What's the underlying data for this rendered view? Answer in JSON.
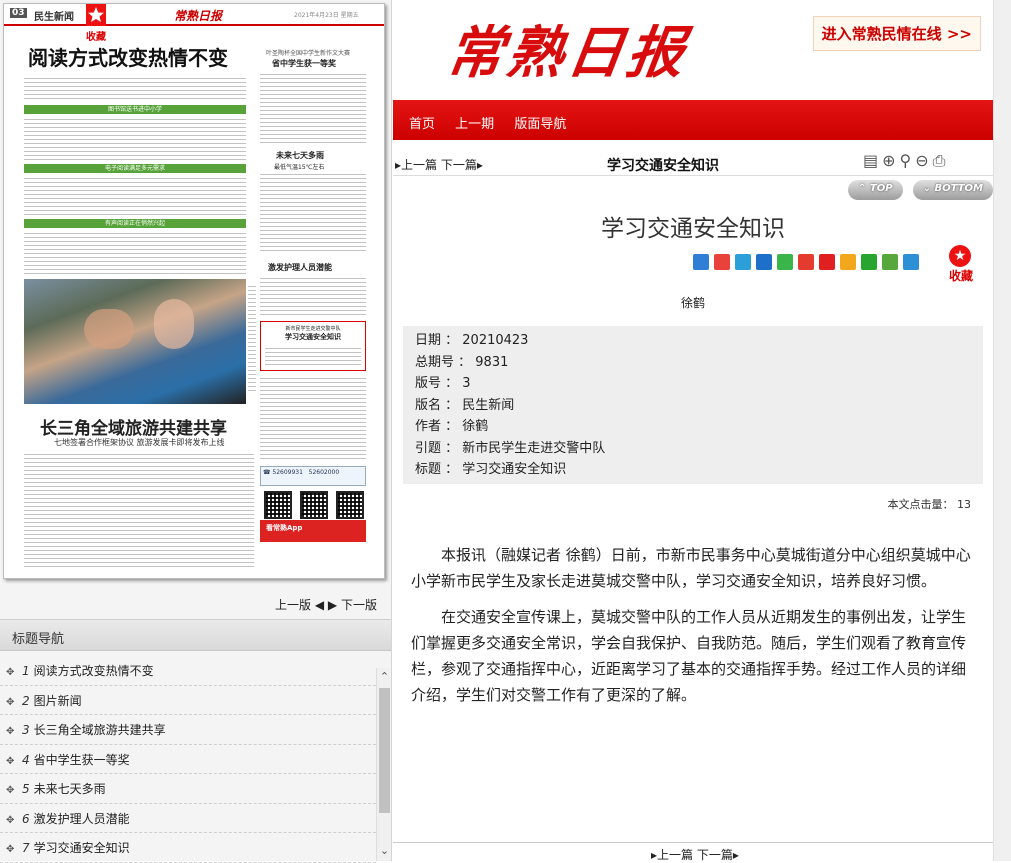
{
  "paper": {
    "page_num": "03",
    "page_category": "民生新闻",
    "collect": "收藏",
    "logo": "常熟日报",
    "lead_headline": "阅读方式改变热情不变",
    "side_kicker": "叶圣陶杯全国中学生新作文大赛",
    "side_headline": "省中学生获一等奖",
    "band1": "图书馆送书进中小学",
    "band2": "电子阅读满足多元需求",
    "band3": "有声阅读正在悄然兴起",
    "weather_headline": "未来七天多雨",
    "weather_sub": "最低气温15℃左右",
    "nurse_headline": "激发护理人员潜能",
    "boxed_kicker": "新市民学生走进交警中队",
    "boxed_headline": "学习交通安全知识",
    "tour_headline": "长三角全域旅游共建共享",
    "tour_sub": "七地签署合作框架协议 旅游发展卡即将发布上线",
    "app_label": "看常熟App"
  },
  "left_pager": {
    "prev": "上一版",
    "next": "下一版"
  },
  "title_nav": {
    "heading": "标题导航",
    "items": [
      {
        "num": "1",
        "label": "阅读方式改变热情不变"
      },
      {
        "num": "2",
        "label": "图片新闻"
      },
      {
        "num": "3",
        "label": "长三角全域旅游共建共享"
      },
      {
        "num": "4",
        "label": "省中学生获一等奖"
      },
      {
        "num": "5",
        "label": "未来七天多雨"
      },
      {
        "num": "6",
        "label": "激发护理人员潜能"
      },
      {
        "num": "7",
        "label": "学习交通安全知识"
      }
    ]
  },
  "masthead": {
    "logo": "常熟日报",
    "enter_link": "进入常熟民情在线 >>"
  },
  "nav": {
    "home": "首页",
    "prev_issue": "上一期",
    "page_nav": "版面导航"
  },
  "toolbar": {
    "prev": "上一篇",
    "next": "下一篇",
    "title": "学习交通安全知识"
  },
  "top_buttons": {
    "top": "TOP",
    "bottom": "BOTTOM"
  },
  "article": {
    "title": "学习交通安全知识",
    "author": "徐鹤",
    "collect": "收藏",
    "meta": [
      {
        "k": "日期",
        "v": "20210423"
      },
      {
        "k": "总期号",
        "v": "9831"
      },
      {
        "k": "版号",
        "v": "3"
      },
      {
        "k": "版名",
        "v": "民生新闻"
      },
      {
        "k": "作者",
        "v": "徐鹤"
      },
      {
        "k": "引题",
        "v": "新市民学生走进交警中队"
      },
      {
        "k": "标题",
        "v": "学习交通安全知识"
      }
    ],
    "hits_label": "本文点击量：",
    "hits_value": "13",
    "paragraphs": [
      "本报讯（融媒记者 徐鹤）日前，市新市民事务中心莫城街道分中心组织莫城中心小学新市民学生及家长走进莫城交警中队，学习交通安全知识，培养良好习惯。",
      "在交通安全宣传课上，莫城交警中队的工作人员从近期发生的事例出发，让学生们掌握更多交通安全常识，学会自我保护、自我防范。随后，学生们观看了教育宣传栏，参观了交通指挥中心，近距离学习了基本的交通指挥手势。经过工作人员的详细介绍，学生们对交警工作有了更深的了解。"
    ]
  },
  "share_colors": [
    "#2f7fd6",
    "#e8423b",
    "#2a9fd8",
    "#1d6fc8",
    "#3ab54a",
    "#e33b2e",
    "#e02020",
    "#f2a71d",
    "#27a52f",
    "#56a83c",
    "#2d8fd5"
  ]
}
